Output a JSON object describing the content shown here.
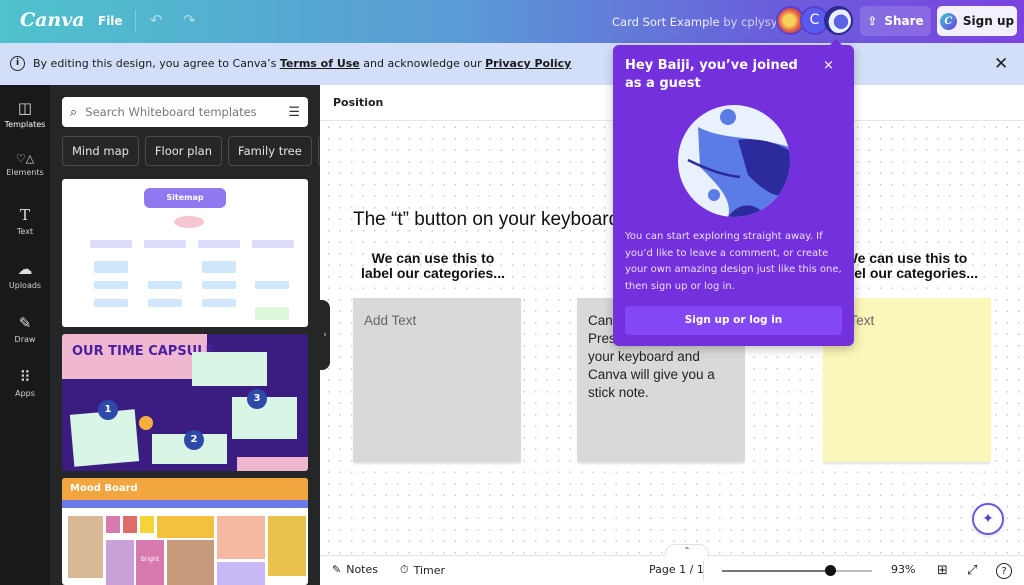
{
  "topbar": {
    "logo": "Canva",
    "file_label": "File",
    "undo_icon": "↶",
    "redo_icon": "↷",
    "doc_title": "Card Sort Example",
    "doc_by": "by cplysy",
    "avatar_letter": "C",
    "share_label": "Share",
    "share_icon": "⇪",
    "signup_label": "Sign up",
    "signup_logo": "C"
  },
  "banner": {
    "prefix": "By editing this design, you agree to Canva’s ",
    "terms_link": "Terms of Use",
    "middle": " and acknowledge our ",
    "privacy_link": "Privacy Policy",
    "close_icon": "✕"
  },
  "rail": {
    "items": [
      {
        "label": "Templates",
        "icon": "◫"
      },
      {
        "label": "Elements",
        "icon": "♡△"
      },
      {
        "label": "Text",
        "icon": "T"
      },
      {
        "label": "Uploads",
        "icon": "☁"
      },
      {
        "label": "Draw",
        "icon": "✎"
      },
      {
        "label": "Apps",
        "icon": "⠿"
      }
    ]
  },
  "panel": {
    "search_placeholder": "Search Whiteboard templates",
    "chips": [
      "Mind map",
      "Floor plan",
      "Family tree"
    ],
    "chip_more": "›",
    "templates": [
      {
        "title": "Sitemap"
      },
      {
        "title": "OUR TIME CAPSULE",
        "numbers": [
          "1",
          "2",
          "3"
        ]
      },
      {
        "title": "Mood Board",
        "cell_label": "Bright"
      }
    ]
  },
  "canvas": {
    "context_label": "Position",
    "heading": "The “t” button on your keyboard gives you a text block.",
    "category_label_1": "We can use this to\nlabel our categories...",
    "category_label_2": "We can use this to\nlabel our categories...",
    "sticky_notes": [
      {
        "text": "Add Text",
        "placeholder": true,
        "color": "#d9d9d9"
      },
      {
        "text": "Canva’s sticky notes! Press the “s” button on your keyboard and Canva will give you a stick note.",
        "visible_text": "Canv\nPres\nyour keyboard and\nCanva will give you a\nstick note.",
        "placeholder": false,
        "color": "#d9d9d9"
      },
      {
        "text": "Add Text",
        "placeholder": true,
        "color": "#fbf6b9"
      }
    ]
  },
  "popup": {
    "title": "Hey Baiji, you’ve joined as a guest",
    "close_icon": "×",
    "body": "You can start exploring straight away. If you’d like to leave a comment, or create your own amazing design just like this one, then sign up or log in.",
    "button": "Sign up or log in"
  },
  "footer": {
    "notes_label": "Notes",
    "timer_label": "Timer",
    "page_label": "Page 1 / 1",
    "zoom_label": "93%",
    "zoom_fraction": 0.72,
    "expand_icon": "⌃"
  },
  "colors": {
    "accent": "#7530de",
    "popup_button": "#8447f5",
    "sticky_gray": "#d9d9d9",
    "sticky_yellow": "#fbf6b9"
  }
}
